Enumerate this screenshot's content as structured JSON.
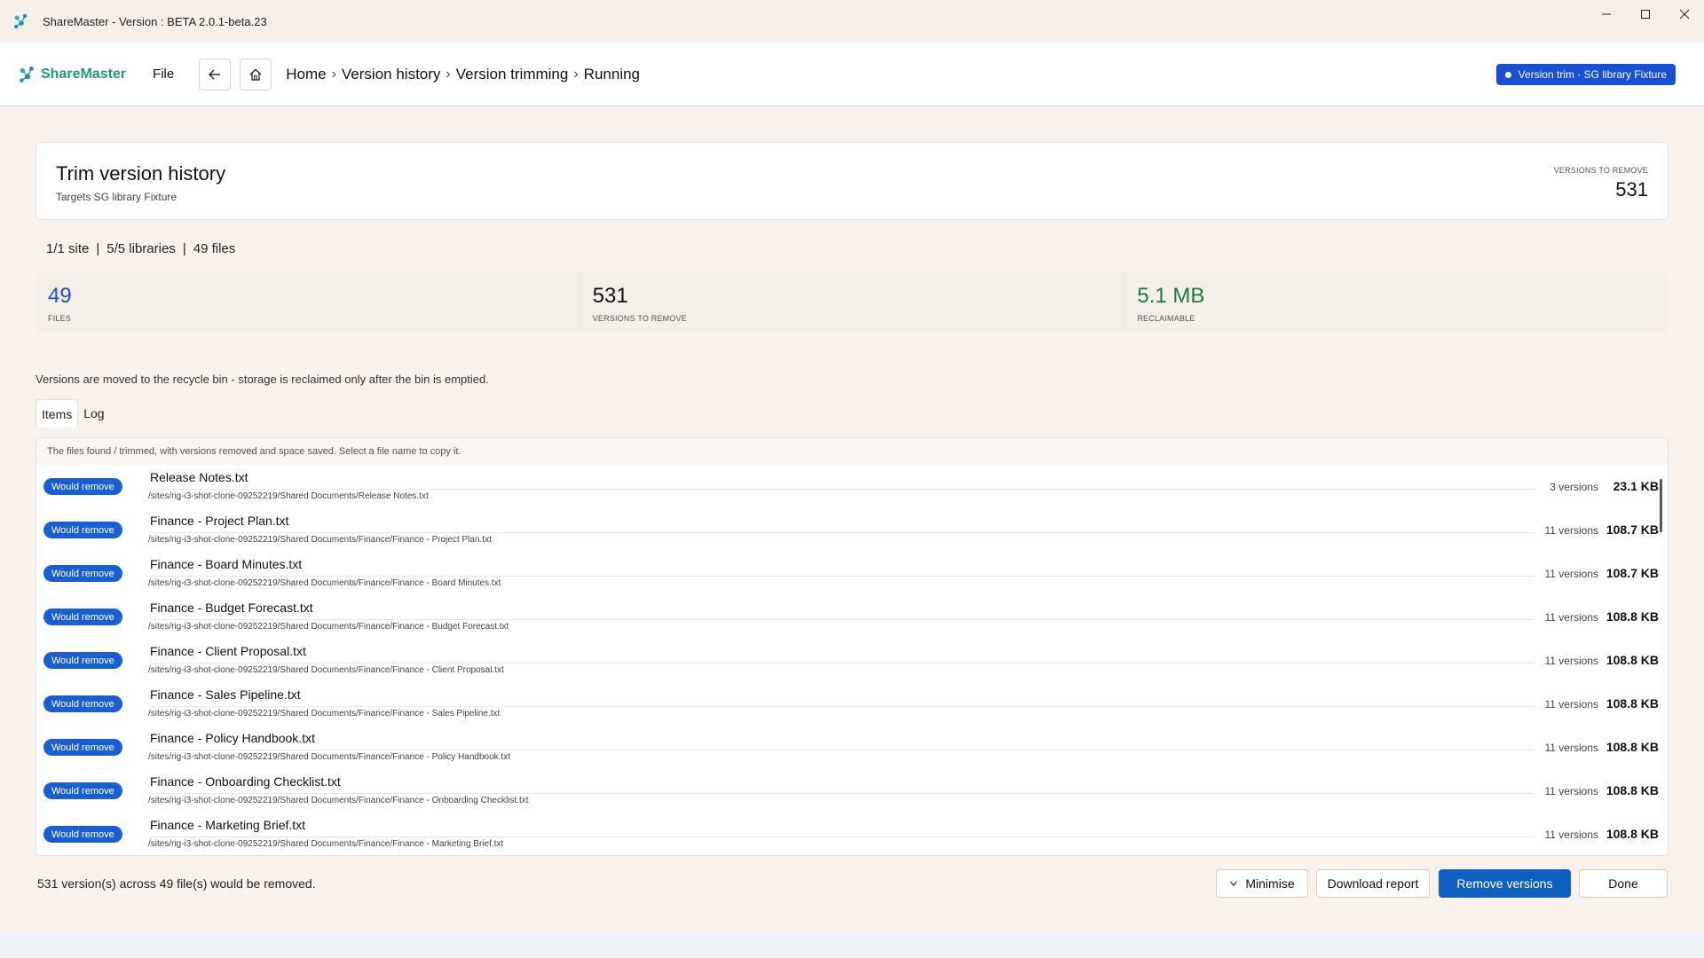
{
  "window": {
    "title": "ShareMaster - Version : BETA 2.0.1-beta.23",
    "minimize_icon": "minimize-icon",
    "maximize_icon": "maximize-icon",
    "close_icon": "close-icon"
  },
  "header": {
    "brand": "ShareMaster",
    "file_menu": "File",
    "breadcrumb": [
      "Home",
      "Version history",
      "Version trimming",
      "Running"
    ],
    "status_pill": "Version trim · SG library Fixture"
  },
  "summary": {
    "title": "Trim version history",
    "subtitle": "Targets SG library Fixture",
    "versions_label": "VERSIONS TO REMOVE",
    "versions_value": "531"
  },
  "scope": {
    "sites": "1/1 site",
    "libraries": "5/5 libraries",
    "files": "49 files"
  },
  "stats": [
    {
      "value": "49",
      "label": "FILES",
      "color": "#1a4fd0"
    },
    {
      "value": "531",
      "label": "VERSIONS TO REMOVE",
      "color": "#111111"
    },
    {
      "value": "5.1 MB",
      "label": "RECLAIMABLE",
      "color": "#1e7a34"
    }
  ],
  "notice": "Versions are moved to the recycle bin - storage is reclaimed only after the bin is emptied.",
  "tabs": [
    "Items",
    "Log"
  ],
  "items_hint": "The files found / trimmed, with versions removed and space saved. Select a file name to copy it.",
  "items": [
    {
      "badge": "Would remove",
      "name": "Release Notes.txt",
      "path": "/sites/rig-i3-shot-clone-09252219/Shared Documents/Release Notes.txt",
      "versions": "3 versions",
      "size": "23.1 KB"
    },
    {
      "badge": "Would remove",
      "name": "Finance - Project Plan.txt",
      "path": "/sites/rig-i3-shot-clone-09252219/Shared Documents/Finance/Finance - Project Plan.txt",
      "versions": "11 versions",
      "size": "108.7 KB"
    },
    {
      "badge": "Would remove",
      "name": "Finance - Board Minutes.txt",
      "path": "/sites/rig-i3-shot-clone-09252219/Shared Documents/Finance/Finance - Board Minutes.txt",
      "versions": "11 versions",
      "size": "108.7 KB"
    },
    {
      "badge": "Would remove",
      "name": "Finance - Budget Forecast.txt",
      "path": "/sites/rig-i3-shot-clone-09252219/Shared Documents/Finance/Finance - Budget Forecast.txt",
      "versions": "11 versions",
      "size": "108.8 KB"
    },
    {
      "badge": "Would remove",
      "name": "Finance - Client Proposal.txt",
      "path": "/sites/rig-i3-shot-clone-09252219/Shared Documents/Finance/Finance - Client Proposal.txt",
      "versions": "11 versions",
      "size": "108.8 KB"
    },
    {
      "badge": "Would remove",
      "name": "Finance - Sales Pipeline.txt",
      "path": "/sites/rig-i3-shot-clone-09252219/Shared Documents/Finance/Finance - Sales Pipeline.txt",
      "versions": "11 versions",
      "size": "108.8 KB"
    },
    {
      "badge": "Would remove",
      "name": "Finance - Policy Handbook.txt",
      "path": "/sites/rig-i3-shot-clone-09252219/Shared Documents/Finance/Finance - Policy Handbook.txt",
      "versions": "11 versions",
      "size": "108.8 KB"
    },
    {
      "badge": "Would remove",
      "name": "Finance - Onboarding Checklist.txt",
      "path": "/sites/rig-i3-shot-clone-09252219/Shared Documents/Finance/Finance - Onboarding Checklist.txt",
      "versions": "11 versions",
      "size": "108.8 KB"
    },
    {
      "badge": "Would remove",
      "name": "Finance - Marketing Brief.txt",
      "path": "/sites/rig-i3-shot-clone-09252219/Shared Documents/Finance/Finance - Marketing Brief.txt",
      "versions": "11 versions",
      "size": "108.8 KB"
    }
  ],
  "footer": {
    "summary": "531 version(s) across 49 file(s) would be removed.",
    "minimise": "Minimise",
    "download_report": "Download report",
    "remove_versions": "Remove versions",
    "done": "Done"
  },
  "colors": {
    "accent": "#1a4fd0",
    "primary_button": "#0f5fbf",
    "brand": "#1a9a7a",
    "reclaimable": "#1e7a34"
  }
}
